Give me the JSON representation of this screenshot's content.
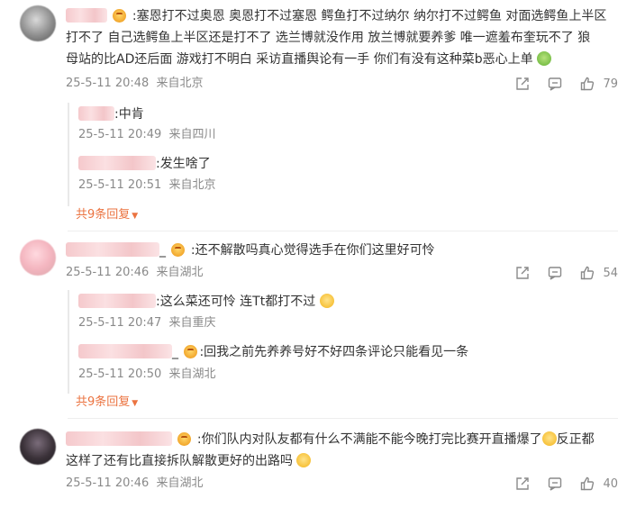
{
  "comments": [
    {
      "text_line1": ":塞恩打不过奥恩 奥恩打不过塞恩 鳄鱼打不过纳尔 纳尔打不过鳄鱼 对面选鳄鱼上半区",
      "text_line2": "打不了 自己选鳄鱼上半区还是打不了 选兰博就没作用 放兰博就要养爹 唯一遮羞布奎玩不了 狼",
      "text_line3": "母站的比AD还后面 游戏打不明白 采访直播舆论有一手 你们有没有这种菜b恶心上单",
      "time": "25-5-11 20:48",
      "location": "来自北京",
      "likes": "79",
      "replies": [
        {
          "text": ":中肯",
          "time": "25-5-11 20:49",
          "location": "来自四川"
        },
        {
          "text": ":发生啥了",
          "time": "25-5-11 20:51",
          "location": "来自北京"
        }
      ],
      "more": "共9条回复"
    },
    {
      "text_line1": ":还不解散吗真心觉得选手在你们这里好可怜",
      "time": "25-5-11 20:46",
      "location": "来自湖北",
      "likes": "54",
      "name_suffix": "_",
      "replies": [
        {
          "text": ":这么菜还可怜 连Tt都打不过",
          "time": "25-5-11 20:47",
          "location": "来自重庆"
        },
        {
          "text": ":回我之前先养养号好不好四条评论只能看见一条",
          "time": "25-5-11 20:50",
          "location": "来自湖北",
          "name_suffix": "_"
        }
      ],
      "more": "共9条回复"
    },
    {
      "text_line1": ":你们队内对队友都有什么不满能不能今晚打完比赛开直播爆了",
      "text_line1_tail": "反正都",
      "text_line2": "这样了还有比直接拆队解散更好的出路吗",
      "time": "25-5-11 20:46",
      "location": "来自湖北",
      "likes": "40"
    }
  ],
  "icons": {
    "share": "share-icon",
    "comment": "comment-icon",
    "like": "thumbs-up-icon",
    "more_arrow": "caret-down-icon",
    "badge": "fan-badge-icon"
  },
  "colors": {
    "accent": "#eb7340",
    "meta": "#8a8a8a",
    "text": "#333333"
  }
}
